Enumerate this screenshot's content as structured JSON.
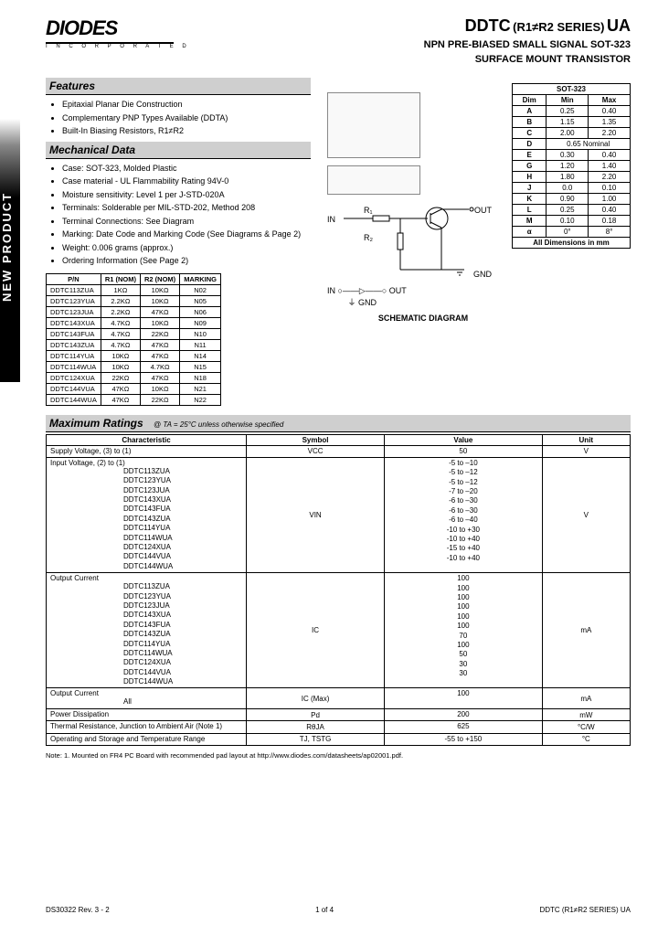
{
  "logo": {
    "main": "DIODES",
    "sub": "I N C O R P O R A T E D"
  },
  "title": {
    "prefix": "DDTC",
    "series": "(R1≠R2 SERIES)",
    "suffix": "UA",
    "line1": "NPN PRE-BIASED SMALL SIGNAL SOT-323",
    "line2": "SURFACE MOUNT TRANSISTOR"
  },
  "newproduct": "NEW PRODUCT",
  "sections": {
    "features": "Features",
    "mech": "Mechanical Data",
    "max": "Maximum Ratings"
  },
  "features": [
    "Epitaxial Planar Die Construction",
    "Complementary PNP Types Available (DDTA)",
    "Built-In Biasing Resistors, R1≠R2"
  ],
  "mech": [
    "Case: SOT-323, Molded Plastic",
    "Case material - UL Flammability Rating 94V-0",
    "Moisture sensitivity: Level 1 per J-STD-020A",
    "Terminals: Solderable per MIL-STD-202, Method 208",
    "Terminal Connections: See Diagram",
    "Marking: Date Code and Marking Code (See Diagrams & Page 2)",
    "Weight: 0.006 grams (approx.)",
    "Ordering Information (See Page 2)"
  ],
  "pn_headers": [
    "P/N",
    "R1 (NOM)",
    "R2 (NOM)",
    "MARKING"
  ],
  "pn_rows": [
    [
      "DDTC113ZUA",
      "1KΩ",
      "10KΩ",
      "N02"
    ],
    [
      "DDTC123YUA",
      "2.2KΩ",
      "10KΩ",
      "N05"
    ],
    [
      "DDTC123JUA",
      "2.2KΩ",
      "47KΩ",
      "N06"
    ],
    [
      "DDTC143XUA",
      "4.7KΩ",
      "10KΩ",
      "N09"
    ],
    [
      "DDTC143FUA",
      "4.7KΩ",
      "22KΩ",
      "N10"
    ],
    [
      "DDTC143ZUA",
      "4.7KΩ",
      "47KΩ",
      "N11"
    ],
    [
      "DDTC114YUA",
      "10KΩ",
      "47KΩ",
      "N14"
    ],
    [
      "DDTC114WUA",
      "10KΩ",
      "4.7KΩ",
      "N15"
    ],
    [
      "DDTC124XUA",
      "22KΩ",
      "47KΩ",
      "N18"
    ],
    [
      "DDTC144VUA",
      "47KΩ",
      "10KΩ",
      "N21"
    ],
    [
      "DDTC144WUA",
      "47KΩ",
      "22KΩ",
      "N22"
    ]
  ],
  "pkg_title": "SOT-323",
  "pkg_headers": [
    "Dim",
    "Min",
    "Max"
  ],
  "pkg_rows": [
    [
      "A",
      "0.25",
      "0.40"
    ],
    [
      "B",
      "1.15",
      "1.35"
    ],
    [
      "C",
      "2.00",
      "2.20"
    ],
    [
      "D",
      "0.65 Nominal",
      ""
    ],
    [
      "E",
      "0.30",
      "0.40"
    ],
    [
      "G",
      "1.20",
      "1.40"
    ],
    [
      "H",
      "1.80",
      "2.20"
    ],
    [
      "J",
      "0.0",
      "0.10"
    ],
    [
      "K",
      "0.90",
      "1.00"
    ],
    [
      "L",
      "0.25",
      "0.40"
    ],
    [
      "M",
      "0.10",
      "0.18"
    ],
    [
      "α",
      "0°",
      "8°"
    ]
  ],
  "pkg_footer": "All Dimensions in mm",
  "schematic": {
    "in": "IN",
    "out": "OUT",
    "gnd": "GND",
    "r1": "R₁",
    "r2": "R₂",
    "caption": "SCHEMATIC DIAGRAM"
  },
  "mr_note": "@ TA = 25°C unless otherwise specified",
  "mr_headers": [
    "Characteristic",
    "Symbol",
    "Value",
    "Unit"
  ],
  "mr_rows": [
    {
      "char": "Supply Voltage, (3) to (1)",
      "parts": [],
      "sym": "VCC",
      "vals": [
        "50"
      ],
      "unit": "V"
    },
    {
      "char": "Input Voltage, (2) to (1)",
      "parts": [
        "DDTC113ZUA",
        "DDTC123YUA",
        "DDTC123JUA",
        "DDTC143XUA",
        "DDTC143FUA",
        "DDTC143ZUA",
        "DDTC114YUA",
        "DDTC114WUA",
        "DDTC124XUA",
        "DDTC144VUA",
        "DDTC144WUA"
      ],
      "sym": "VIN",
      "vals": [
        "-5 to –10",
        "-5 to –12",
        "-5 to –12",
        "-7 to –20",
        "-6 to –30",
        "-6 to –30",
        "-6 to –40",
        "-10 to +30",
        "-10 to +40",
        "-15 to +40",
        "-10 to +40"
      ],
      "unit": "V"
    },
    {
      "char": "Output Current",
      "parts": [
        "DDTC113ZUA",
        "DDTC123YUA",
        "DDTC123JUA",
        "DDTC143XUA",
        "DDTC143FUA",
        "DDTC143ZUA",
        "DDTC114YUA",
        "DDTC114WUA",
        "DDTC124XUA",
        "DDTC144VUA",
        "DDTC144WUA"
      ],
      "sym": "IC",
      "vals": [
        "100",
        "100",
        "100",
        "100",
        "100",
        "100",
        "70",
        "100",
        "50",
        "30",
        "30"
      ],
      "unit": "mA"
    },
    {
      "char": "Output Current",
      "parts": [
        "All"
      ],
      "sym": "IC (Max)",
      "vals": [
        "100"
      ],
      "unit": "mA"
    },
    {
      "char": "Power Dissipation",
      "parts": [],
      "sym": "Pd",
      "vals": [
        "200"
      ],
      "unit": "mW"
    },
    {
      "char": "Thermal Resistance, Junction to Ambient Air (Note 1)",
      "parts": [],
      "sym": "RθJA",
      "vals": [
        "625"
      ],
      "unit": "°C/W"
    },
    {
      "char": "Operating and Storage and Temperature Range",
      "parts": [],
      "sym": "TJ, TSTG",
      "vals": [
        "-55 to +150"
      ],
      "unit": "°C"
    }
  ],
  "note": "Note:    1.  Mounted on FR4 PC Board with recommended pad layout at http://www.diodes.com/datasheets/ap02001.pdf.",
  "footer": {
    "left": "DS30322 Rev. 3 - 2",
    "center": "1 of 4",
    "right": "DDTC (R1≠R2 SERIES) UA"
  }
}
